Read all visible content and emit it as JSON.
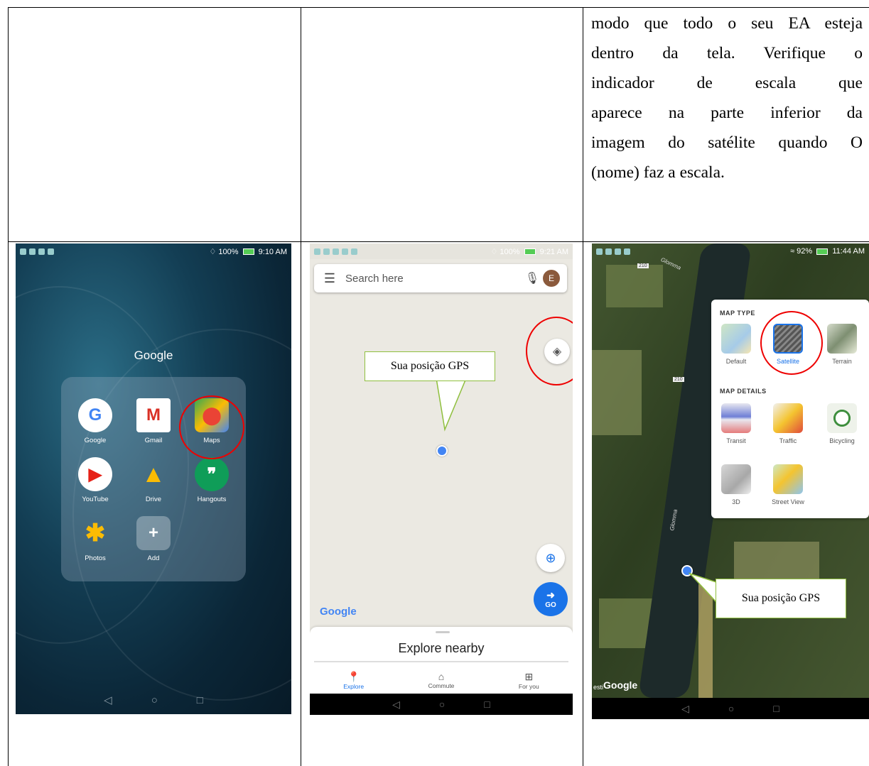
{
  "paragraph": {
    "lines": [
      "modo que todo o seu EA esteja",
      "dentro da tela. Verifique o",
      "indicador de escala que",
      "aparece na parte inferior da",
      "imagem do satélite quando O",
      "(nome) faz a escala."
    ]
  },
  "phone1": {
    "status_time": "9:10 AM",
    "status_battery": "100%",
    "folder_title": "Google",
    "apps": [
      {
        "label": "Google",
        "icon": "google-icon"
      },
      {
        "label": "Gmail",
        "icon": "gmail-icon"
      },
      {
        "label": "Maps",
        "icon": "maps-icon"
      },
      {
        "label": "YouTube",
        "icon": "youtube-icon"
      },
      {
        "label": "Drive",
        "icon": "drive-icon"
      },
      {
        "label": "Hangouts",
        "icon": "hangouts-icon"
      },
      {
        "label": "Photos",
        "icon": "photos-icon"
      },
      {
        "label": "Add",
        "icon": "add-icon"
      }
    ]
  },
  "phone2": {
    "status_time": "9:21 AM",
    "status_battery": "100%",
    "search_placeholder": "Search here",
    "avatar_letter": "E",
    "callout_text": "Sua posição GPS",
    "go_label": "GO",
    "logo": "Google",
    "sheet_title": "Explore nearby",
    "tabs": [
      "Explore",
      "Commute",
      "For you"
    ]
  },
  "phone3": {
    "status_time": "11:44 AM",
    "status_battery": "92%",
    "map_type_heading": "MAP TYPE",
    "map_details_heading": "MAP DETAILS",
    "types": [
      "Default",
      "Satellite",
      "Terrain"
    ],
    "details": [
      "Transit",
      "Traffic",
      "Bicycling",
      "3D",
      "Street View"
    ],
    "callout_text": "Sua posição GPS",
    "logo": "Google",
    "logo_prefix": "esti",
    "road_labels": [
      "210",
      "210",
      "Glomma",
      "Glomma"
    ]
  },
  "colors": {
    "accent_blue": "#1a73e8",
    "highlight_red": "#e00000",
    "callout_border": "#8fbf3e"
  }
}
